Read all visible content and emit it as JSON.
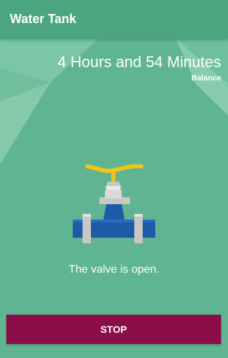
{
  "app": {
    "title": "Water Tank"
  },
  "balance": {
    "value": "4 Hours and 54 Minutes",
    "label": "Balance"
  },
  "valve": {
    "state_text": "The valve is open.",
    "icon": "valve-icon"
  },
  "actions": {
    "stop_label": "STOP"
  },
  "colors": {
    "background": "#5fb592",
    "appbar": "#4ba57f",
    "stop_button": "#8c0e48",
    "pipe": "#1e5aa8",
    "handle": "#f2c418"
  }
}
